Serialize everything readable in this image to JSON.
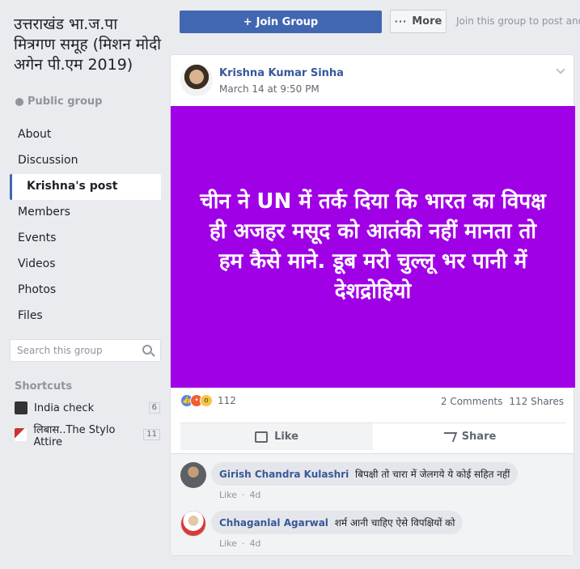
{
  "group": {
    "title": "उत्तराखंड भा.ज.पा मित्रगण समूह (मिशन मोदी अगेन पी.एम 2019)",
    "privacy": "Public group"
  },
  "nav": {
    "items": [
      "About",
      "Discussion",
      "Krishna's post",
      "Members",
      "Events",
      "Videos",
      "Photos",
      "Files"
    ],
    "active": "Krishna's post"
  },
  "search": {
    "placeholder": "Search this group"
  },
  "shortcuts": {
    "heading": "Shortcuts",
    "items": [
      {
        "label": "India check",
        "count": "6"
      },
      {
        "label": "लिबास..The Stylo Attire",
        "count": "11"
      }
    ]
  },
  "topbar": {
    "join_label": "Join Group",
    "join_prefix": "+",
    "more_label": "More",
    "more_dots": "···",
    "hint": "Join this group to post and co"
  },
  "post": {
    "author": "Krishna Kumar Sinha",
    "timestamp": "March 14 at 9:50 PM",
    "banner_text": "चीन ने UN में तर्क दिया कि भारत का विपक्ष ही अजहर मसूद को आतंकी नहीं मानता तो हम कैसे माने. डूब मरो चुल्लू भर पानी में देशद्रोहियो",
    "banner_color": "#a000e6",
    "reaction_count": "112",
    "comments_count": "2 Comments",
    "shares_count": "112 Shares",
    "like_label": "Like",
    "share_label": "Share"
  },
  "comments": [
    {
      "name": "Girish Chandra Kulashri",
      "text": "बिपक्षी तो चारा में जेलगये ये कोई सहित नहीं",
      "like": "Like",
      "time": "4d"
    },
    {
      "name": "Chhaganlal Agarwal",
      "text": "शर्म आनी चाहिए ऐसे विपक्षियों को",
      "like": "Like",
      "time": "4d"
    }
  ],
  "colors": {
    "brand": "#4267b2",
    "link": "#365899",
    "page_bg": "#e9ebee"
  }
}
